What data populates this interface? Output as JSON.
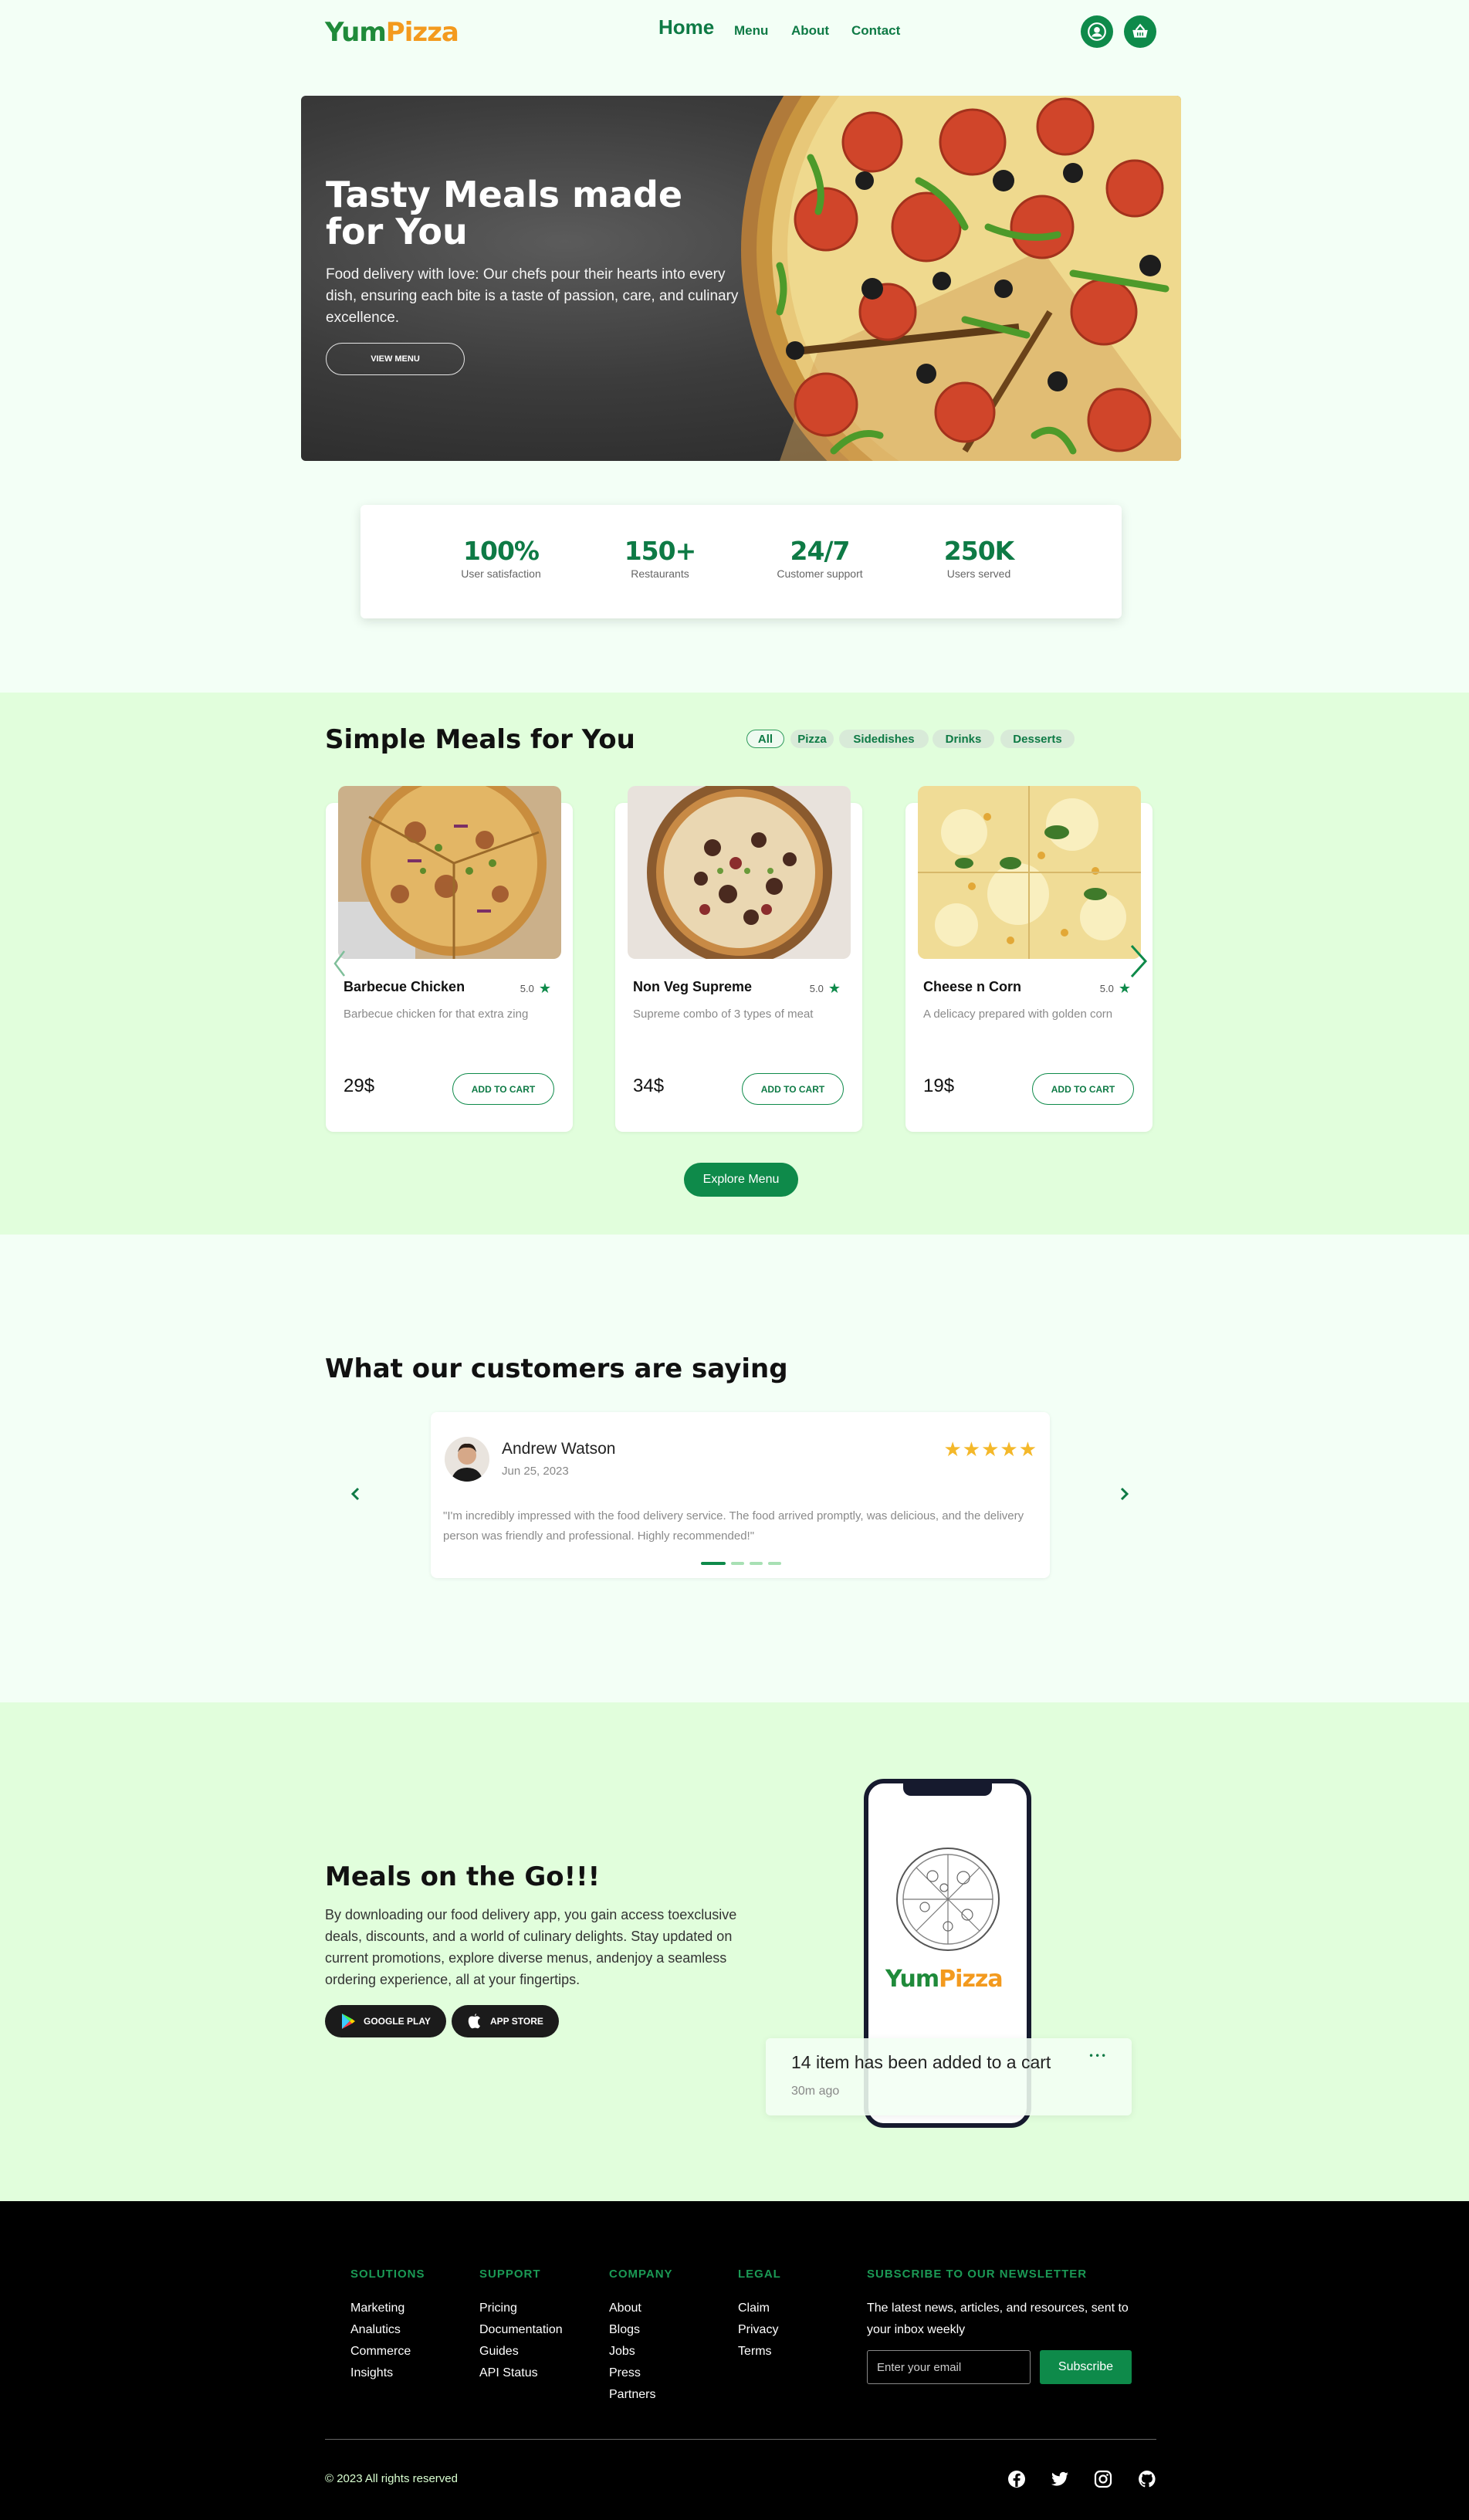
{
  "nav": {
    "logo_yum": "Yum",
    "logo_pizza": "Pizza",
    "links": [
      "Home",
      "Menu",
      "About",
      "Contact"
    ]
  },
  "hero": {
    "title": "Tasty Meals made for You",
    "text": "Food delivery with love: Our chefs pour their hearts into every dish, ensuring each bite is a taste of passion, care, and culinary excellence.",
    "button": "VIEW MENU"
  },
  "stats": [
    {
      "value": "100%",
      "label": "User satisfaction"
    },
    {
      "value": "150+",
      "label": "Restaurants"
    },
    {
      "value": "24/7",
      "label": "Customer support"
    },
    {
      "value": "250K",
      "label": "Users served"
    }
  ],
  "meals": {
    "title": "Simple Meals for You",
    "filters": [
      "All",
      "Pizza",
      "Sidedishes",
      "Drinks",
      "Desserts"
    ],
    "items": [
      {
        "name": "Barbecue Chicken",
        "rating": "5.0",
        "desc": "Barbecue chicken for that extra zing",
        "price": "29$",
        "button": "ADD TO CART"
      },
      {
        "name": "Non Veg Supreme",
        "rating": "5.0",
        "desc": "Supreme combo of 3 types of meat",
        "price": "34$",
        "button": "ADD TO CART"
      },
      {
        "name": "Cheese n Corn",
        "rating": "5.0",
        "desc": "A delicacy prepared with golden corn",
        "price": "19$",
        "button": "ADD TO CART"
      }
    ],
    "explore": "Explore Menu"
  },
  "testimonials": {
    "title": "What our customers are saying",
    "name": "Andrew Watson",
    "date": "Jun 25, 2023",
    "stars": "★★★★★",
    "quote": "\"I'm incredibly impressed with the food delivery service. The food arrived promptly, was delicious, and the delivery person was friendly and professional. Highly recommended!\""
  },
  "app": {
    "title": "Meals on the Go!!!",
    "text": "By downloading our food delivery app, you gain access toexclusive deals, discounts, and a world of culinary delights. Stay updated on current promotions, explore diverse menus, andenjoy a seamless ordering experience, all at your fingertips.",
    "google": "GOOGLE PLAY",
    "apple": "APP STORE",
    "phone_logo_yum": "Yum",
    "phone_logo_pizza": "Pizza",
    "notification": "14 item has been added to a cart",
    "notification_time": "30m ago",
    "notification_more": "•••"
  },
  "footer": {
    "columns": [
      {
        "head": "SOLUTIONS",
        "items": [
          "Marketing",
          "Analutics",
          "Commerce",
          "Insights"
        ]
      },
      {
        "head": "SUPPORT",
        "items": [
          "Pricing",
          "Documentation",
          "Guides",
          "API Status"
        ]
      },
      {
        "head": "COMPANY",
        "items": [
          "About",
          "Blogs",
          "Jobs",
          "Press",
          "Partners"
        ]
      },
      {
        "head": "LEGAL",
        "items": [
          "Claim",
          "Privacy",
          "Terms"
        ]
      }
    ],
    "newsletter_head": "SUBSCRIBE TO OUR NEWSLETTER",
    "newsletter_text": "The latest news, articles, and resources, sent to your inbox weekly",
    "email_placeholder": "Enter your email",
    "subscribe": "Subscribe",
    "copyright": "© 2023 All rights reserved",
    "social_icons": [
      "facebook-icon",
      "twitter-icon",
      "instagram-icon",
      "github-icon"
    ]
  },
  "colors": {
    "brand_green": "#0e8a4a",
    "brand_orange": "#f39a1e",
    "section_bg": "#e1fedc",
    "page_bg": "#f3fff6",
    "star": "#f4b82a"
  }
}
